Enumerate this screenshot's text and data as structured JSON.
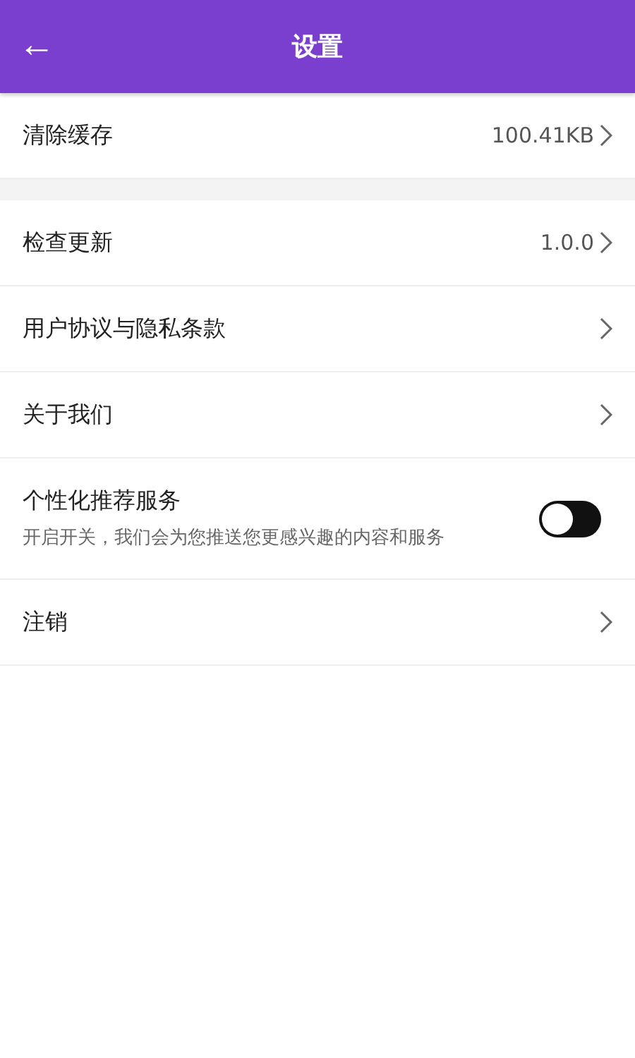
{
  "header": {
    "back": "←",
    "title": "设置"
  },
  "groups": [
    {
      "items": [
        {
          "kind": "link",
          "label": "清除缓存",
          "value": "100.41KB"
        }
      ]
    },
    {
      "items": [
        {
          "kind": "link",
          "label": "检查更新",
          "value": "1.0.0"
        },
        {
          "kind": "link",
          "label": "用户协议与隐私条款"
        },
        {
          "kind": "link",
          "label": "关于我们"
        },
        {
          "kind": "toggle",
          "label": "个性化推荐服务",
          "description": "开启开关，我们会为您推送您更感兴趣的内容和服务",
          "on": false
        },
        {
          "kind": "link",
          "label": "注销"
        }
      ]
    }
  ]
}
